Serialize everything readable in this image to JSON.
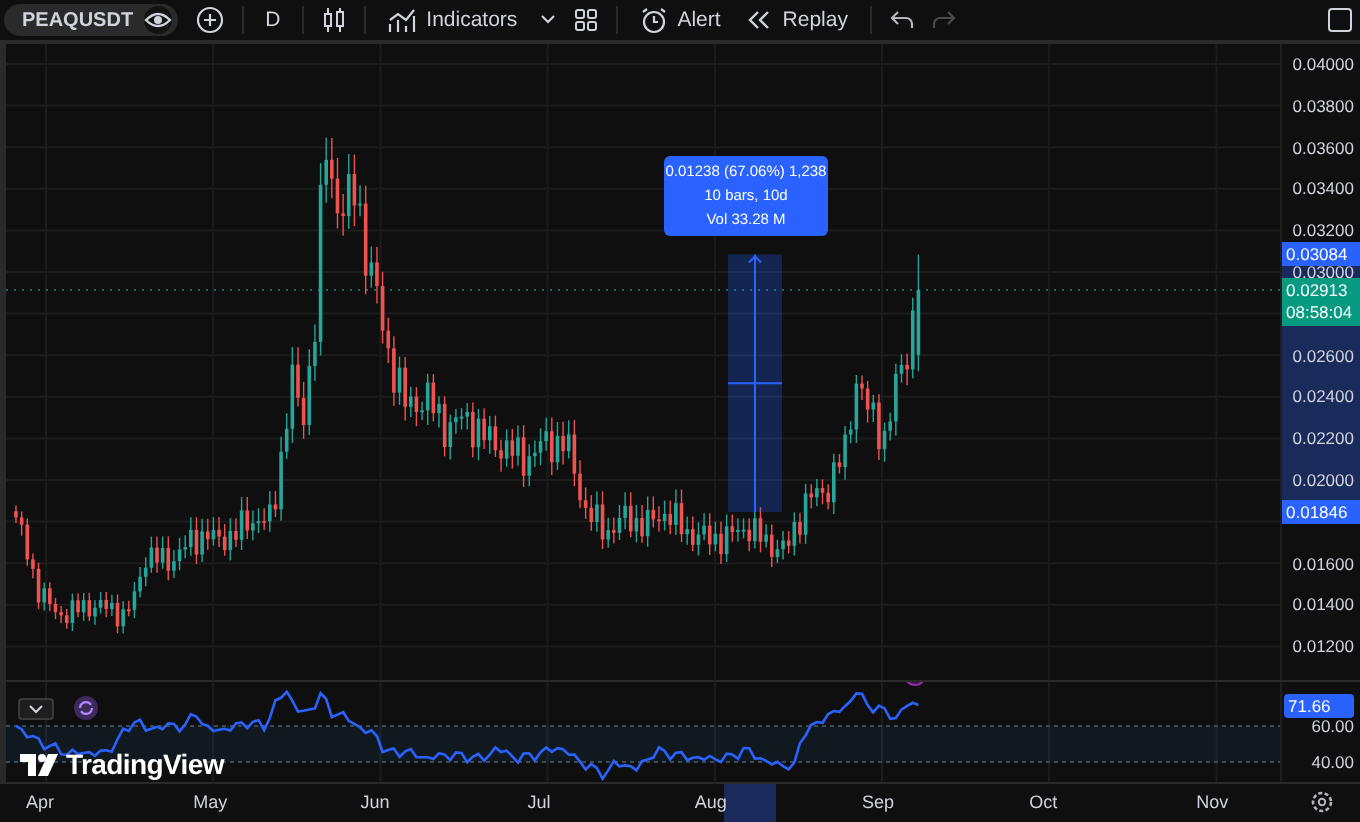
{
  "toolbar": {
    "symbol": "PEAQUSDT",
    "interval": "D",
    "indicators": "Indicators",
    "alert": "Alert",
    "replay": "Replay"
  },
  "price_axis": {
    "labels": [
      "0.04000",
      "0.03800",
      "0.03600",
      "0.03400",
      "0.03200",
      "0.03000",
      "0.02600",
      "0.02400",
      "0.02200",
      "0.02000",
      "0.01600",
      "0.01400",
      "0.01200"
    ]
  },
  "price_badges": [
    {
      "kind": "range",
      "text": "0.03084"
    },
    {
      "kind": "last",
      "text": "0.02913",
      "timer": "08:58:04"
    },
    {
      "kind": "range",
      "text": "0.01846"
    }
  ],
  "measure_tooltip": {
    "lines": [
      "0.01238 (67.06%) 1,238",
      "10 bars, 10d",
      "Vol 33.28 M"
    ]
  },
  "rsi": {
    "value": "71.66",
    "labels": [
      "60.00",
      "40.00"
    ]
  },
  "logo": "TradingView",
  "time_axis": {
    "labels": [
      "Apr",
      "May",
      "Jun",
      "Jul",
      "Aug",
      "Sep",
      "Oct",
      "Nov"
    ]
  }
}
